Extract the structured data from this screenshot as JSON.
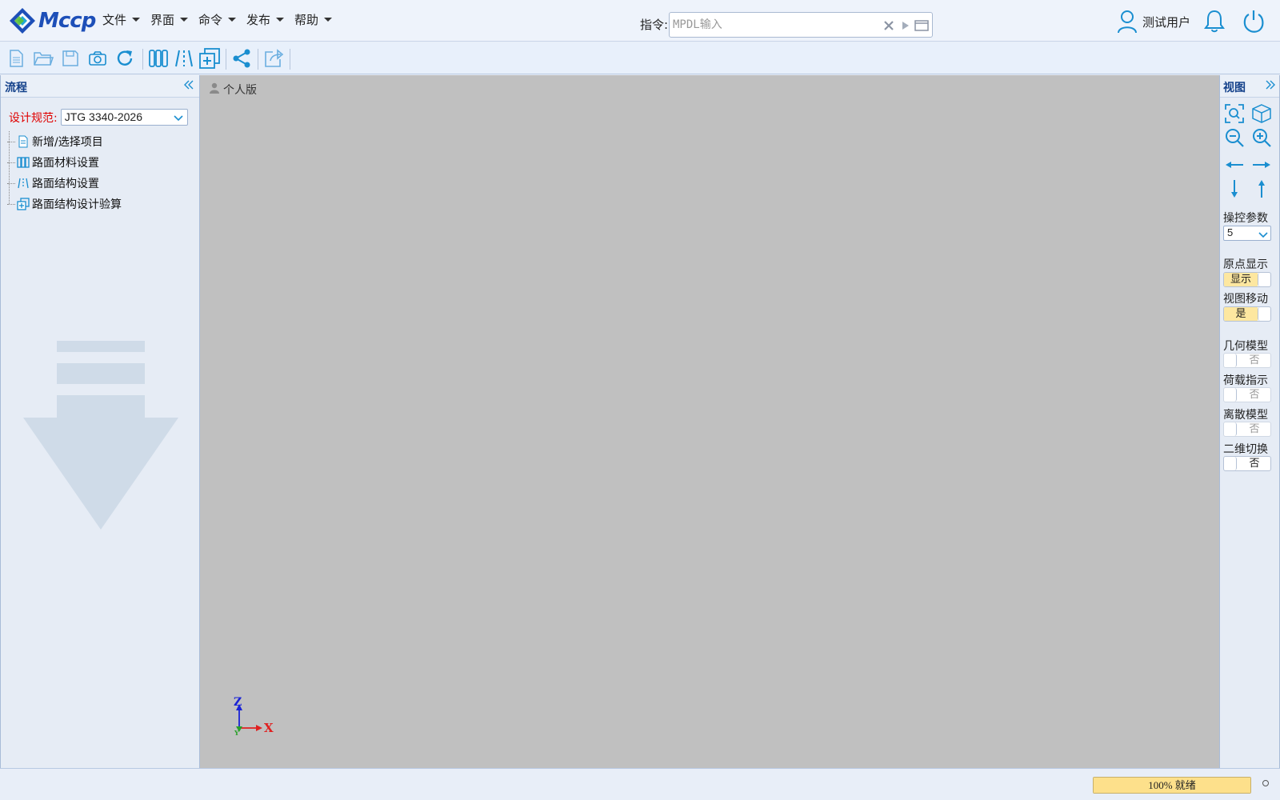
{
  "header": {
    "logo_text": "Mccp",
    "menus": [
      {
        "label": "文件"
      },
      {
        "label": "界面"
      },
      {
        "label": "命令"
      },
      {
        "label": "发布"
      },
      {
        "label": "帮助"
      }
    ],
    "command": {
      "label": "指令:",
      "placeholder": "MPDL输入",
      "value": ""
    },
    "user_name": "测试用户",
    "icons": [
      "user-icon",
      "bell-icon",
      "power-icon"
    ]
  },
  "toolbar": {
    "buttons": [
      "new-file-icon",
      "open-folder-icon",
      "save-icon",
      "camera-icon",
      "refresh-icon",
      "material-columns-icon",
      "structure-lines-icon",
      "design-check-icon",
      "share-icon",
      "export-icon"
    ]
  },
  "left_panel": {
    "title": "流程",
    "spec_label": "设计规范:",
    "spec_value": "JTG 3340-2026",
    "tree": [
      {
        "label": "新增/选择项目",
        "icon": "document-icon"
      },
      {
        "label": "路面材料设置",
        "icon": "columns-icon"
      },
      {
        "label": "路面结构设置",
        "icon": "lines-icon"
      },
      {
        "label": "路面结构设计验算",
        "icon": "check-copy-icon"
      }
    ]
  },
  "viewport": {
    "edition": "个人版",
    "axis_labels": {
      "z": "Z",
      "y": "Y",
      "x": "X"
    }
  },
  "right_panel": {
    "title": "视图",
    "control_param_label": "操控参数",
    "control_param_value": "5",
    "toggles": [
      {
        "label": "原点显示",
        "state": "显示",
        "on": true
      },
      {
        "label": "视图移动",
        "state": "是",
        "on": true
      },
      {
        "label": "几何模型",
        "state": "否",
        "on": false
      },
      {
        "label": "荷载指示",
        "state": "否",
        "on": false
      },
      {
        "label": "离散模型",
        "state": "否",
        "on": false
      },
      {
        "label": "二维切换",
        "state": "否",
        "on": false
      }
    ]
  },
  "status": {
    "progress_text": "100% 就绪",
    "progress_fraction": 1.0
  },
  "colors": {
    "accent": "#1a8ed0",
    "logo_blue": "#1d4fb8",
    "spec_label": "#e00000",
    "viewport_bg": "#c0c0c0",
    "toggle_on": "#fde7a0"
  }
}
